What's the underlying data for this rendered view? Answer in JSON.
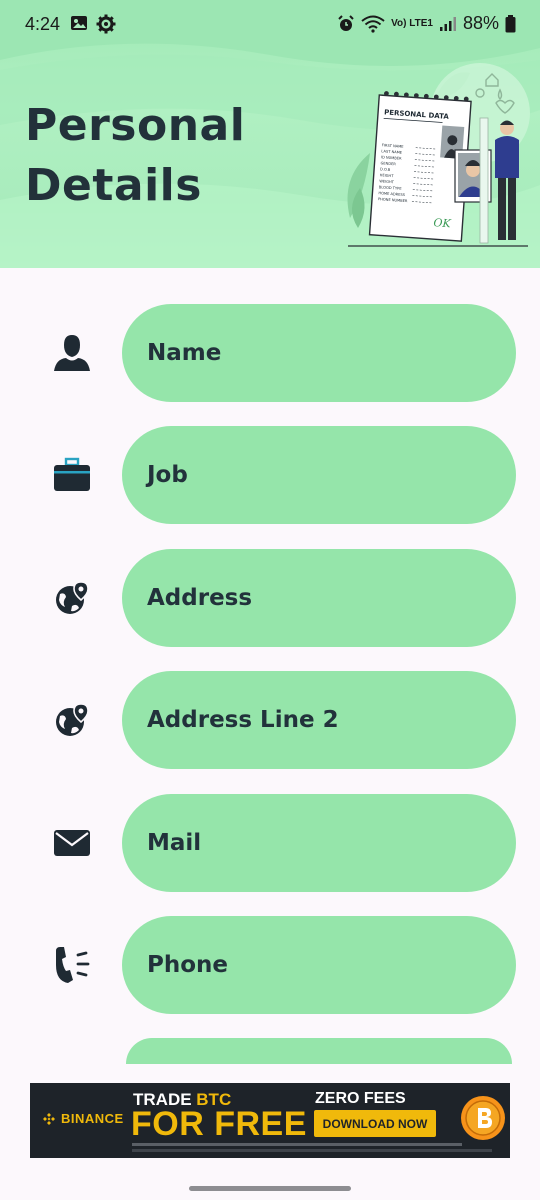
{
  "status_bar": {
    "time": "4:24",
    "battery": "88%",
    "network": "Vo) LTE1"
  },
  "header": {
    "title_line1": "Personal",
    "title_line2": "Details",
    "illustration": {
      "heading": "PERSONAL DATA",
      "fields": [
        "FIRST NAME",
        "LAST NAME",
        "ID NUMBER",
        "GENDER",
        "D.O.B",
        "HEIGHT",
        "WEIGHT",
        "BLOOD TYPE",
        "HOME ADRESS",
        "PHONE NUMBER"
      ],
      "signature": "OK"
    }
  },
  "form": {
    "fields": [
      {
        "label": "Name",
        "icon": "person-icon"
      },
      {
        "label": "Job",
        "icon": "briefcase-icon"
      },
      {
        "label": "Address",
        "icon": "globe-pin-icon"
      },
      {
        "label": "Address Line 2",
        "icon": "globe-pin-icon"
      },
      {
        "label": "Mail",
        "icon": "envelope-icon"
      },
      {
        "label": "Phone",
        "icon": "phone-ringing-icon"
      }
    ]
  },
  "ad": {
    "brand": "BINANCE",
    "trade_prefix": "TRADE ",
    "trade_highlight": "BTC",
    "headline": "FOR FREE",
    "subheadline": "ZERO FEES",
    "cta": "DOWNLOAD NOW"
  },
  "colors": {
    "header_bg": "#aeefc0",
    "field_bg": "#95e5aa",
    "text_dark": "#1f2a33",
    "page_bg": "#fcf8fc",
    "ad_bg": "#1e2329",
    "ad_accent": "#f0b90b"
  }
}
